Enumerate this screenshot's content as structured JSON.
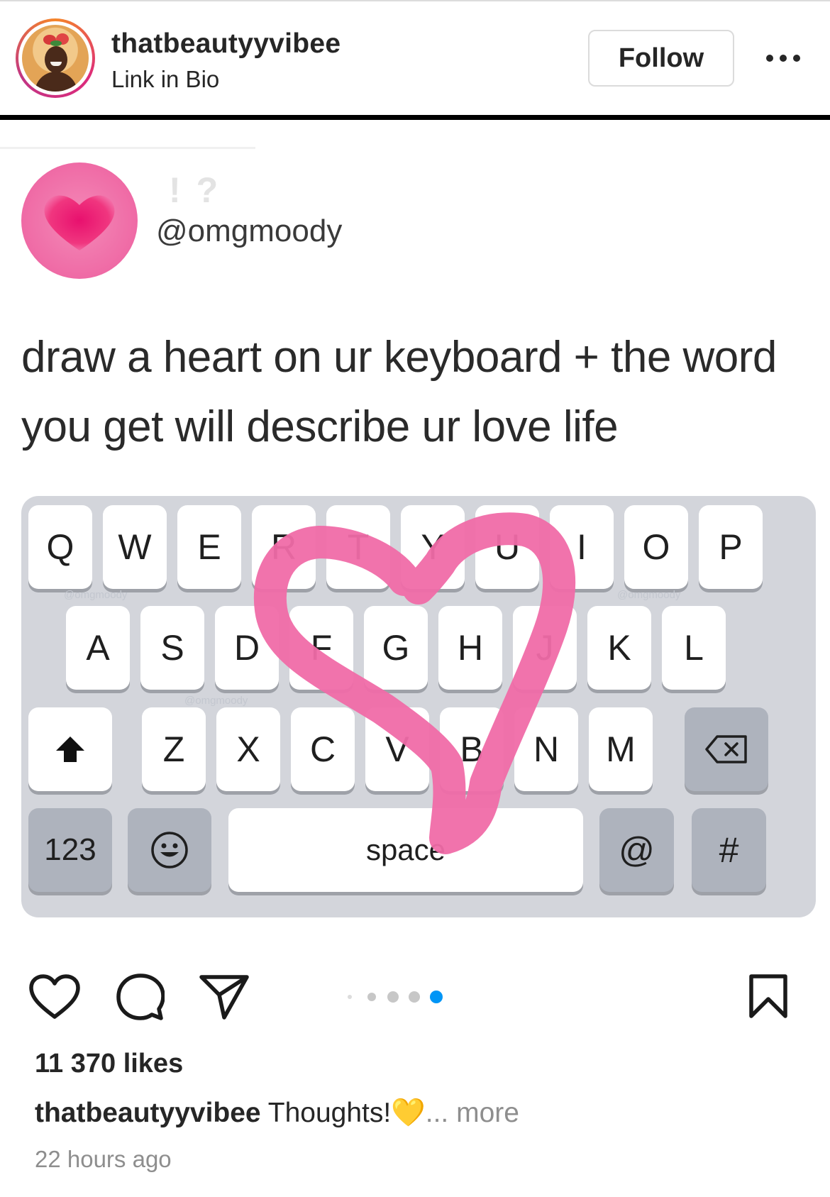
{
  "header": {
    "username": "thatbeautyyvibee",
    "subtitle": "Link in Bio",
    "follow_label": "Follow"
  },
  "post": {
    "handle": "@omgmoody",
    "text": "draw a heart on ur keyboard + the word you get will describe ur love life",
    "keyboard": {
      "row1": [
        "Q",
        "W",
        "E",
        "R",
        "T",
        "Y",
        "U",
        "I",
        "O",
        "P"
      ],
      "row2": [
        "A",
        "S",
        "D",
        "F",
        "G",
        "H",
        "J",
        "K",
        "L"
      ],
      "row3": [
        "Z",
        "X",
        "C",
        "V",
        "B",
        "N",
        "M"
      ],
      "number_key": "123",
      "space_key": "space",
      "at_key": "@",
      "hash_key": "#",
      "watermark": "@omgmoody"
    },
    "colors": {
      "heart": "#f06ba8",
      "keyboard_bg": "#d3d5db",
      "active_dot": "#0095f6"
    }
  },
  "actions": {
    "icons": [
      "heart-icon",
      "comment-icon",
      "share-icon",
      "bookmark-icon"
    ],
    "carousel_total": 5,
    "carousel_active": 5
  },
  "stats": {
    "likes": "11 370 likes"
  },
  "caption": {
    "user": "thatbeautyyvibee",
    "text": " Thoughts!",
    "emoji": "💛",
    "more": "... more"
  },
  "timestamp": "22 hours ago"
}
